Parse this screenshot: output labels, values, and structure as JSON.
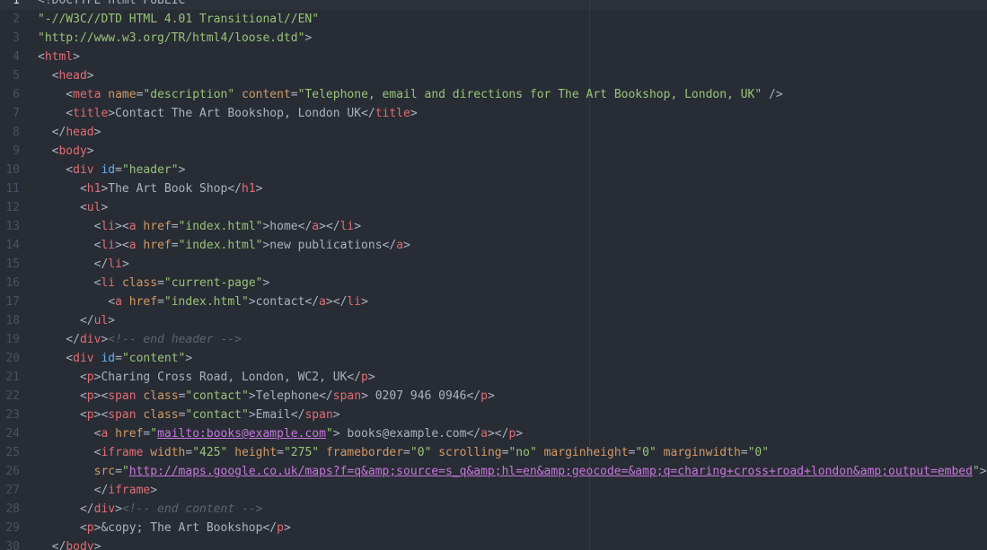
{
  "editor": {
    "first_line_number": 1,
    "active_line": 1,
    "lines": [
      {
        "n": "1",
        "tokens": [
          [
            "t",
            "<!DOCTYPE html PUBLIC"
          ]
        ]
      },
      {
        "n": "2",
        "tokens": [
          [
            "str",
            "\"-//W3C//DTD HTML 4.01 Transitional//EN\""
          ]
        ]
      },
      {
        "n": "3",
        "tokens": [
          [
            "str",
            "\"http://www.w3.org/TR/html4/loose.dtd\""
          ],
          [
            "t",
            ">"
          ]
        ]
      },
      {
        "n": "4",
        "tokens": [
          [
            "t",
            "<"
          ],
          [
            "tag",
            "html"
          ],
          [
            "t",
            ">"
          ]
        ]
      },
      {
        "n": "5",
        "tokens": [
          [
            "t",
            "  <"
          ],
          [
            "tag",
            "head"
          ],
          [
            "t",
            ">"
          ]
        ]
      },
      {
        "n": "6",
        "tokens": [
          [
            "t",
            "    <"
          ],
          [
            "tag",
            "meta"
          ],
          [
            "t",
            " "
          ],
          [
            "attr",
            "name"
          ],
          [
            "t",
            "="
          ],
          [
            "str",
            "\"description\""
          ],
          [
            "t",
            " "
          ],
          [
            "attr",
            "content"
          ],
          [
            "t",
            "="
          ],
          [
            "str",
            "\"Telephone, email and directions for The Art Bookshop, London, UK\""
          ],
          [
            "t",
            " />"
          ]
        ]
      },
      {
        "n": "7",
        "tokens": [
          [
            "t",
            "    <"
          ],
          [
            "tag",
            "title"
          ],
          [
            "t",
            ">Contact The Art Bookshop, London UK</"
          ],
          [
            "tag",
            "title"
          ],
          [
            "t",
            ">"
          ]
        ]
      },
      {
        "n": "8",
        "tokens": [
          [
            "t",
            "  </"
          ],
          [
            "tag",
            "head"
          ],
          [
            "t",
            ">"
          ]
        ]
      },
      {
        "n": "9",
        "tokens": [
          [
            "t",
            "  <"
          ],
          [
            "tag",
            "body"
          ],
          [
            "t",
            ">"
          ]
        ]
      },
      {
        "n": "10",
        "tokens": [
          [
            "t",
            "    <"
          ],
          [
            "tag",
            "div"
          ],
          [
            "t",
            " "
          ],
          [
            "attr-id",
            "id"
          ],
          [
            "t",
            "="
          ],
          [
            "str",
            "\"header\""
          ],
          [
            "t",
            ">"
          ]
        ]
      },
      {
        "n": "11",
        "tokens": [
          [
            "t",
            "      <"
          ],
          [
            "tag",
            "h1"
          ],
          [
            "t",
            ">The Art Book Shop</"
          ],
          [
            "tag",
            "h1"
          ],
          [
            "t",
            ">"
          ]
        ]
      },
      {
        "n": "12",
        "tokens": [
          [
            "t",
            "      <"
          ],
          [
            "tag",
            "ul"
          ],
          [
            "t",
            ">"
          ]
        ]
      },
      {
        "n": "13",
        "tokens": [
          [
            "t",
            "        <"
          ],
          [
            "tag",
            "li"
          ],
          [
            "t",
            "><"
          ],
          [
            "tag",
            "a"
          ],
          [
            "t",
            " "
          ],
          [
            "attr",
            "href"
          ],
          [
            "t",
            "="
          ],
          [
            "str",
            "\"index.html\""
          ],
          [
            "t",
            ">home</"
          ],
          [
            "tag",
            "a"
          ],
          [
            "t",
            "></"
          ],
          [
            "tag",
            "li"
          ],
          [
            "t",
            ">"
          ]
        ]
      },
      {
        "n": "14",
        "tokens": [
          [
            "t",
            "        <"
          ],
          [
            "tag",
            "li"
          ],
          [
            "t",
            "><"
          ],
          [
            "tag",
            "a"
          ],
          [
            "t",
            " "
          ],
          [
            "attr",
            "href"
          ],
          [
            "t",
            "="
          ],
          [
            "str",
            "\"index.html\""
          ],
          [
            "t",
            ">new publications</"
          ],
          [
            "tag",
            "a"
          ],
          [
            "t",
            ">"
          ]
        ]
      },
      {
        "n": "15",
        "tokens": [
          [
            "t",
            "        </"
          ],
          [
            "tag",
            "li"
          ],
          [
            "t",
            ">"
          ]
        ]
      },
      {
        "n": "16",
        "tokens": [
          [
            "t",
            "        <"
          ],
          [
            "tag",
            "li"
          ],
          [
            "t",
            " "
          ],
          [
            "attr",
            "class"
          ],
          [
            "t",
            "="
          ],
          [
            "str",
            "\"current-page\""
          ],
          [
            "t",
            ">"
          ]
        ]
      },
      {
        "n": "17",
        "tokens": [
          [
            "t",
            "          <"
          ],
          [
            "tag",
            "a"
          ],
          [
            "t",
            " "
          ],
          [
            "attr",
            "href"
          ],
          [
            "t",
            "="
          ],
          [
            "str",
            "\"index.html\""
          ],
          [
            "t",
            ">contact</"
          ],
          [
            "tag",
            "a"
          ],
          [
            "t",
            "></"
          ],
          [
            "tag",
            "li"
          ],
          [
            "t",
            ">"
          ]
        ]
      },
      {
        "n": "18",
        "tokens": [
          [
            "t",
            "      </"
          ],
          [
            "tag",
            "ul"
          ],
          [
            "t",
            ">"
          ]
        ]
      },
      {
        "n": "19",
        "tokens": [
          [
            "t",
            "    </"
          ],
          [
            "tag",
            "div"
          ],
          [
            "t",
            ">"
          ],
          [
            "cm",
            "<!-- end header -->"
          ]
        ]
      },
      {
        "n": "20",
        "tokens": [
          [
            "t",
            "    <"
          ],
          [
            "tag",
            "div"
          ],
          [
            "t",
            " "
          ],
          [
            "attr-id",
            "id"
          ],
          [
            "t",
            "="
          ],
          [
            "str",
            "\"content\""
          ],
          [
            "t",
            ">"
          ]
        ]
      },
      {
        "n": "21",
        "tokens": [
          [
            "t",
            "      <"
          ],
          [
            "tag",
            "p"
          ],
          [
            "t",
            ">Charing Cross Road, London, WC2, UK</"
          ],
          [
            "tag",
            "p"
          ],
          [
            "t",
            ">"
          ]
        ]
      },
      {
        "n": "22",
        "tokens": [
          [
            "t",
            "      <"
          ],
          [
            "tag",
            "p"
          ],
          [
            "t",
            "><"
          ],
          [
            "tag",
            "span"
          ],
          [
            "t",
            " "
          ],
          [
            "attr",
            "class"
          ],
          [
            "t",
            "="
          ],
          [
            "str",
            "\"contact\""
          ],
          [
            "t",
            ">Telephone</"
          ],
          [
            "tag",
            "span"
          ],
          [
            "t",
            "> 0207 946 0946</"
          ],
          [
            "tag",
            "p"
          ],
          [
            "t",
            ">"
          ]
        ]
      },
      {
        "n": "23",
        "tokens": [
          [
            "t",
            "      <"
          ],
          [
            "tag",
            "p"
          ],
          [
            "t",
            "><"
          ],
          [
            "tag",
            "span"
          ],
          [
            "t",
            " "
          ],
          [
            "attr",
            "class"
          ],
          [
            "t",
            "="
          ],
          [
            "str",
            "\"contact\""
          ],
          [
            "t",
            ">Email</"
          ],
          [
            "tag",
            "span"
          ],
          [
            "t",
            ">"
          ]
        ]
      },
      {
        "n": "24",
        "tokens": [
          [
            "t",
            "        <"
          ],
          [
            "tag",
            "a"
          ],
          [
            "t",
            " "
          ],
          [
            "attr",
            "href"
          ],
          [
            "t",
            "="
          ],
          [
            "str-link",
            "\""
          ],
          [
            "link",
            "mailto:books@example.com"
          ],
          [
            "str-link",
            "\""
          ],
          [
            "t",
            "> books@example.com</"
          ],
          [
            "tag",
            "a"
          ],
          [
            "t",
            "></"
          ],
          [
            "tag",
            "p"
          ],
          [
            "t",
            ">"
          ]
        ]
      },
      {
        "n": "25",
        "tokens": [
          [
            "t",
            "        <"
          ],
          [
            "tag",
            "iframe"
          ],
          [
            "t",
            " "
          ],
          [
            "attr",
            "width"
          ],
          [
            "t",
            "="
          ],
          [
            "str",
            "\"425\""
          ],
          [
            "t",
            " "
          ],
          [
            "attr",
            "height"
          ],
          [
            "t",
            "="
          ],
          [
            "str",
            "\"275\""
          ],
          [
            "t",
            " "
          ],
          [
            "attr",
            "frameborder"
          ],
          [
            "t",
            "="
          ],
          [
            "str",
            "\"0\""
          ],
          [
            "t",
            " "
          ],
          [
            "attr",
            "scrolling"
          ],
          [
            "t",
            "="
          ],
          [
            "str",
            "\"no\""
          ],
          [
            "t",
            " "
          ],
          [
            "attr",
            "marginheight"
          ],
          [
            "t",
            "="
          ],
          [
            "str",
            "\"0\""
          ],
          [
            "t",
            " "
          ],
          [
            "attr",
            "marginwidth"
          ],
          [
            "t",
            "="
          ],
          [
            "str",
            "\"0\""
          ]
        ]
      },
      {
        "n": "26",
        "tokens": [
          [
            "t",
            "        "
          ],
          [
            "attr",
            "src"
          ],
          [
            "t",
            "="
          ],
          [
            "str-link",
            "\""
          ],
          [
            "link",
            "http://maps.google.co.uk/maps?f=q&amp;source=s_q&amp;hl=en&amp;geocode=&amp;q=charing+cross+road+london&amp;output=embed"
          ],
          [
            "str-link",
            "\""
          ],
          [
            "t",
            ">"
          ]
        ]
      },
      {
        "n": "27",
        "tokens": [
          [
            "t",
            "        </"
          ],
          [
            "tag",
            "iframe"
          ],
          [
            "t",
            ">"
          ]
        ]
      },
      {
        "n": "28",
        "tokens": [
          [
            "t",
            "      </"
          ],
          [
            "tag",
            "div"
          ],
          [
            "t",
            ">"
          ],
          [
            "cm",
            "<!-- end content -->"
          ]
        ]
      },
      {
        "n": "29",
        "tokens": [
          [
            "t",
            "      <"
          ],
          [
            "tag",
            "p"
          ],
          [
            "t",
            ">&copy; The Art Bookshop</"
          ],
          [
            "tag",
            "p"
          ],
          [
            "t",
            ">"
          ]
        ]
      },
      {
        "n": "30",
        "tokens": [
          [
            "t",
            "  </"
          ],
          [
            "tag",
            "body"
          ],
          [
            "t",
            ">"
          ]
        ]
      }
    ]
  }
}
